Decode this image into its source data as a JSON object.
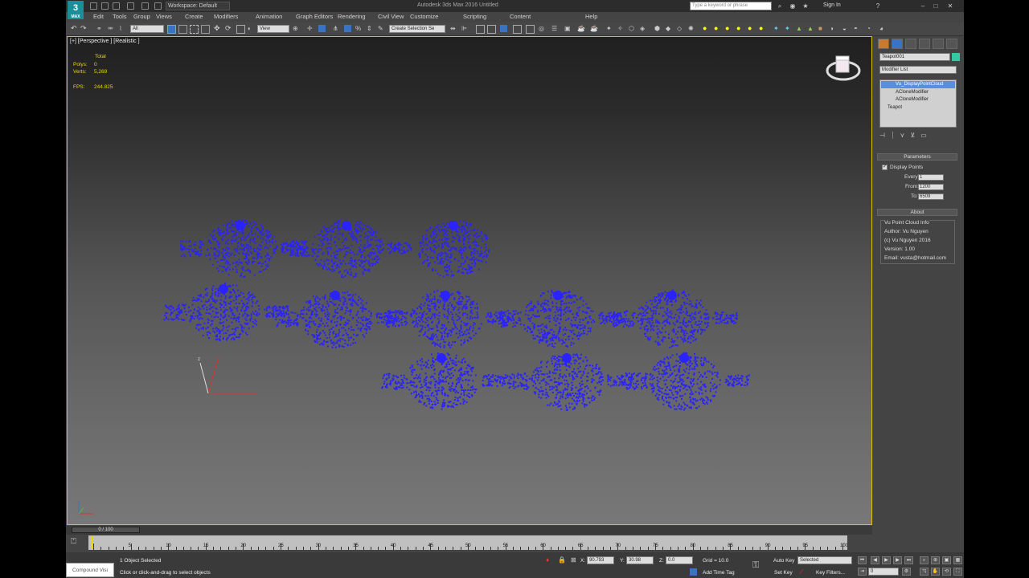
{
  "app": {
    "title": "Autodesk 3ds Max 2016   Untitled",
    "logo": "3",
    "logo_sub": "MAX",
    "workspace": "Workspace: Default",
    "search_placeholder": "Type a keyword or phrase",
    "sign_in": "Sign In"
  },
  "menu": [
    "Edit",
    "Tools",
    "Group",
    "Views",
    "Create",
    "Modifiers",
    "Animation",
    "Graph Editors",
    "Rendering",
    "Civil View",
    "Customize",
    "Scripting",
    "Content",
    "Help"
  ],
  "toolbar": {
    "filter": "All",
    "ref_coord": "View",
    "named_selection": "Create Selection Se"
  },
  "viewport": {
    "label": "[+] [Perspective ] [Realistic ]",
    "stats": {
      "header": "Total",
      "polys_label": "Polys:",
      "polys": "0",
      "verts_label": "Verts:",
      "verts": "5,269",
      "fps_label": "FPS:",
      "fps": "244.825"
    },
    "point_color": "#2a22ff"
  },
  "command_panel": {
    "object_name": "Teapot001",
    "object_color": "#36c8a0",
    "modifier_list": "Modifier List",
    "stack": [
      "Vu_DisplayPointCloud",
      "ACloneModifier",
      "ACloneModifier",
      "Teapot"
    ],
    "parameters": {
      "title": "Parameters",
      "display_points": "Display Points",
      "every_label": "Every:",
      "every": "1",
      "from_label": "From:",
      "from": "1200",
      "to_label": "To:",
      "to": "6509"
    },
    "about": {
      "title": "About",
      "group": "Vu Point Cloud Info",
      "lines": [
        "Author: Vu Nguyen",
        "(c) Vu Nguyen 2016",
        "Version: 1.00",
        "Email: vusta@hotmail.com"
      ]
    }
  },
  "timeline": {
    "slider": "0 / 100",
    "ticks": [
      "0",
      "5",
      "10",
      "15",
      "20",
      "25",
      "30",
      "35",
      "40",
      "45",
      "50",
      "55",
      "60",
      "65",
      "70",
      "75",
      "80",
      "85",
      "90",
      "95",
      "100"
    ]
  },
  "status": {
    "maxscript": "Compound Visi",
    "selected": "1 Object Selected",
    "prompt": "Click or click-and-drag to select objects",
    "x_label": "X:",
    "x": "90.793",
    "y_label": "Y:",
    "y": "30.98",
    "z_label": "Z:",
    "z": "0.0",
    "grid": "Grid = 10.0",
    "add_time_tag": "Add Time Tag",
    "auto_key": "Auto Key",
    "key_mode": "Selected",
    "set_key": "Set Key",
    "key_filters": "Key Filters...",
    "frame": "0"
  }
}
